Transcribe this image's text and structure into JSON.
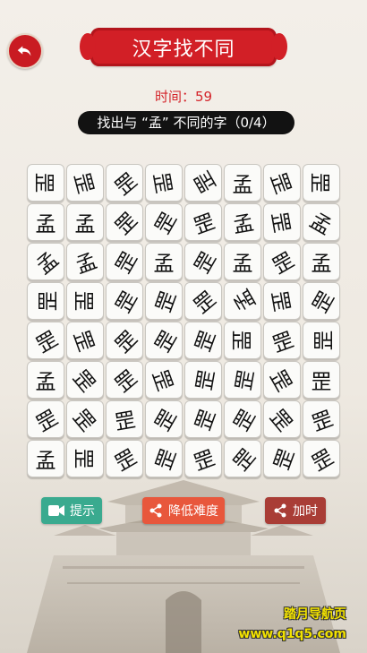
{
  "header": {
    "title": "汉字找不同",
    "timer": "时间：59",
    "instruction": "找出与 “孟” 不同的字（0/4）"
  },
  "grid": {
    "rows": [
      [
        "罡",
        "罡",
        "罡",
        "罡",
        "罡",
        "孟",
        "罡",
        "罡"
      ],
      [
        "孟",
        "孟",
        "罡",
        "罡",
        "罡",
        "孟",
        "罡",
        "孟"
      ],
      [
        "孟",
        "孟",
        "罡",
        "孟",
        "罡",
        "孟",
        "罡",
        "孟"
      ],
      [
        "罡",
        "罡",
        "罡",
        "罡",
        "罡",
        "孟",
        "罡",
        "罡"
      ],
      [
        "罡",
        "罡",
        "罡",
        "罡",
        "罡",
        "罡",
        "罡",
        "罡"
      ],
      [
        "孟",
        "罡",
        "罡",
        "罡",
        "罡",
        "罡",
        "罡",
        "罡"
      ],
      [
        "罡",
        "罡",
        "罡",
        "罡",
        "罡",
        "罡",
        "罡",
        "罡"
      ],
      [
        "孟",
        "罡",
        "罡",
        "罡",
        "罡",
        "罡",
        "罡",
        "罡"
      ]
    ],
    "rotations": [
      [
        90,
        75,
        -40,
        80,
        -120,
        0,
        70,
        90
      ],
      [
        0,
        0,
        -45,
        -60,
        -20,
        -10,
        80,
        30
      ],
      [
        -40,
        -20,
        -60,
        0,
        -60,
        0,
        -30,
        0
      ],
      [
        -90,
        90,
        -60,
        -70,
        -40,
        -120,
        80,
        -60
      ],
      [
        -30,
        70,
        -45,
        -60,
        -70,
        90,
        -20,
        -90
      ],
      [
        0,
        50,
        -40,
        70,
        -80,
        -80,
        60,
        0
      ],
      [
        -30,
        50,
        -10,
        -60,
        -70,
        -60,
        50,
        -20
      ],
      [
        0,
        90,
        -30,
        -70,
        -20,
        -50,
        -70,
        -30
      ]
    ]
  },
  "buttons": {
    "hint": "提示",
    "lower_difficulty": "降低难度",
    "add_time": "加时"
  },
  "watermark": {
    "line1": "踏月导航页",
    "line2": "www.q1q5.com"
  },
  "colors": {
    "title_red": "#d21f26",
    "timer_red": "#d4242a",
    "hint_green": "#3aaa8f",
    "lower_orange": "#e8573c",
    "add_brown": "#a93d36"
  }
}
